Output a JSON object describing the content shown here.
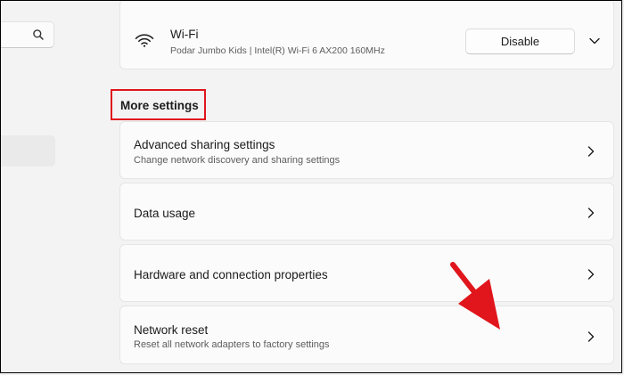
{
  "search": {
    "icon": "search-icon"
  },
  "wifi": {
    "icon": "wifi-icon",
    "title": "Wi-Fi",
    "subtitle": "Podar Jumbo Kids | Intel(R) Wi-Fi 6 AX200 160MHz",
    "button_label": "Disable",
    "expand_icon": "chevron-down-icon"
  },
  "section": {
    "title": "More settings",
    "highlight_color": "#e0161c"
  },
  "settings": [
    {
      "title": "Advanced sharing settings",
      "subtitle": "Change network discovery and sharing settings"
    },
    {
      "title": "Data usage"
    },
    {
      "title": "Hardware and connection properties"
    },
    {
      "title": "Network reset",
      "subtitle": "Reset all network adapters to factory settings"
    }
  ],
  "annotation": {
    "arrow_color": "#e0161c",
    "icon": "red-arrow-icon"
  }
}
